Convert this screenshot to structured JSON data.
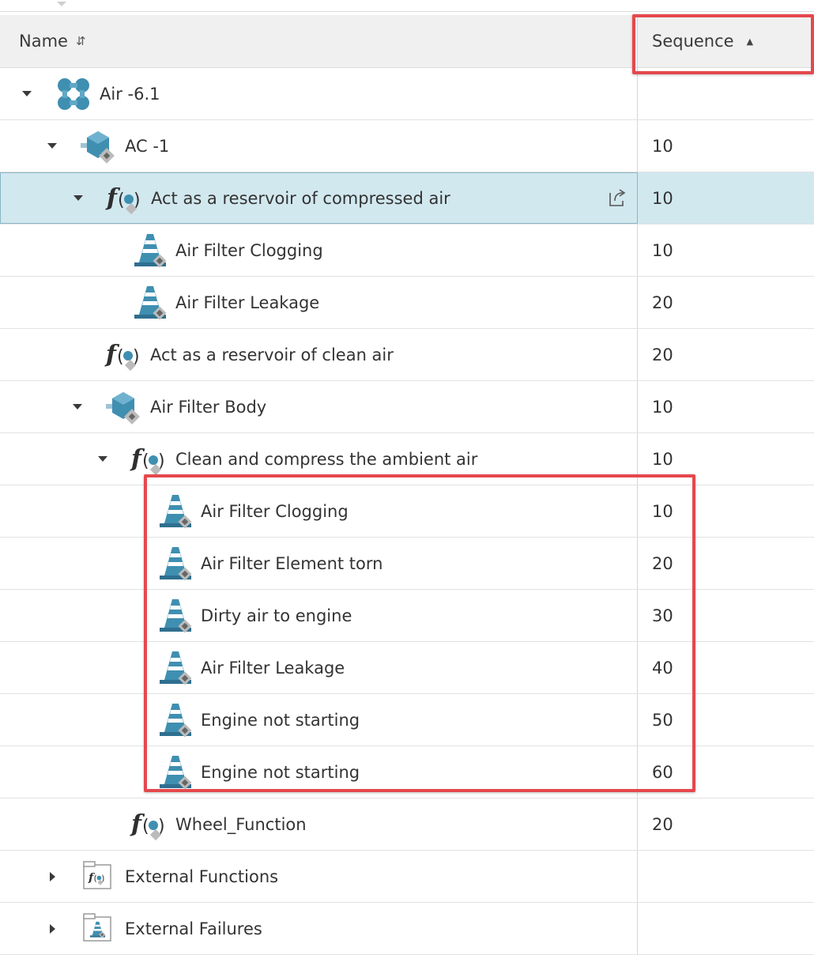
{
  "header": {
    "name_label": "Name",
    "sequence_label": "Sequence",
    "name_sort_icon": "sort-both-icon",
    "sequence_sort_icon": "sort-ascending-icon"
  },
  "rows": [
    {
      "label": "Air -6.1",
      "sequence": "",
      "type": "system",
      "expand": "expanded",
      "depth": 0,
      "selected": false
    },
    {
      "label": "AC -1",
      "sequence": "10",
      "type": "component",
      "expand": "expanded",
      "depth": 1,
      "selected": false
    },
    {
      "label": "Act as a reservoir of compressed air",
      "sequence": "10",
      "type": "function",
      "expand": "expanded",
      "depth": 2,
      "selected": true
    },
    {
      "label": "Air Filter Clogging",
      "sequence": "10",
      "type": "failure",
      "expand": "none",
      "depth": 3,
      "selected": false
    },
    {
      "label": "Air Filter Leakage",
      "sequence": "20",
      "type": "failure",
      "expand": "none",
      "depth": 3,
      "selected": false
    },
    {
      "label": "Act as a reservoir of clean air",
      "sequence": "20",
      "type": "function",
      "expand": "none",
      "depth": 2,
      "selected": false
    },
    {
      "label": "Air Filter Body",
      "sequence": "10",
      "type": "component",
      "expand": "expanded",
      "depth": 2,
      "selected": false
    },
    {
      "label": "Clean and compress the ambient air",
      "sequence": "10",
      "type": "function",
      "expand": "expanded",
      "depth": 3,
      "selected": false
    },
    {
      "label": "Air Filter Clogging",
      "sequence": "10",
      "type": "failure",
      "expand": "none",
      "depth": 4,
      "selected": false
    },
    {
      "label": "Air Filter Element torn",
      "sequence": "20",
      "type": "failure",
      "expand": "none",
      "depth": 4,
      "selected": false
    },
    {
      "label": "Dirty air to engine",
      "sequence": "30",
      "type": "failure",
      "expand": "none",
      "depth": 4,
      "selected": false
    },
    {
      "label": "Air Filter Leakage",
      "sequence": "40",
      "type": "failure",
      "expand": "none",
      "depth": 4,
      "selected": false
    },
    {
      "label": "Engine not starting",
      "sequence": "50",
      "type": "failure",
      "expand": "none",
      "depth": 4,
      "selected": false
    },
    {
      "label": "Engine not starting",
      "sequence": "60",
      "type": "failure",
      "expand": "none",
      "depth": 4,
      "selected": false
    },
    {
      "label": "Wheel_Function",
      "sequence": "20",
      "type": "function",
      "expand": "none",
      "depth": 3,
      "selected": false
    },
    {
      "label": "External Functions",
      "sequence": "",
      "type": "external-functions",
      "expand": "collapsed",
      "depth": 1,
      "selected": false
    },
    {
      "label": "External Failures",
      "sequence": "",
      "type": "external-failures",
      "expand": "collapsed",
      "depth": 1,
      "selected": false
    }
  ],
  "colors": {
    "selected_row": "#d2e8ef",
    "highlight_border": "#e5484d",
    "header_bg": "#f0f0f0",
    "icon_blue": "#3f8fb1"
  }
}
